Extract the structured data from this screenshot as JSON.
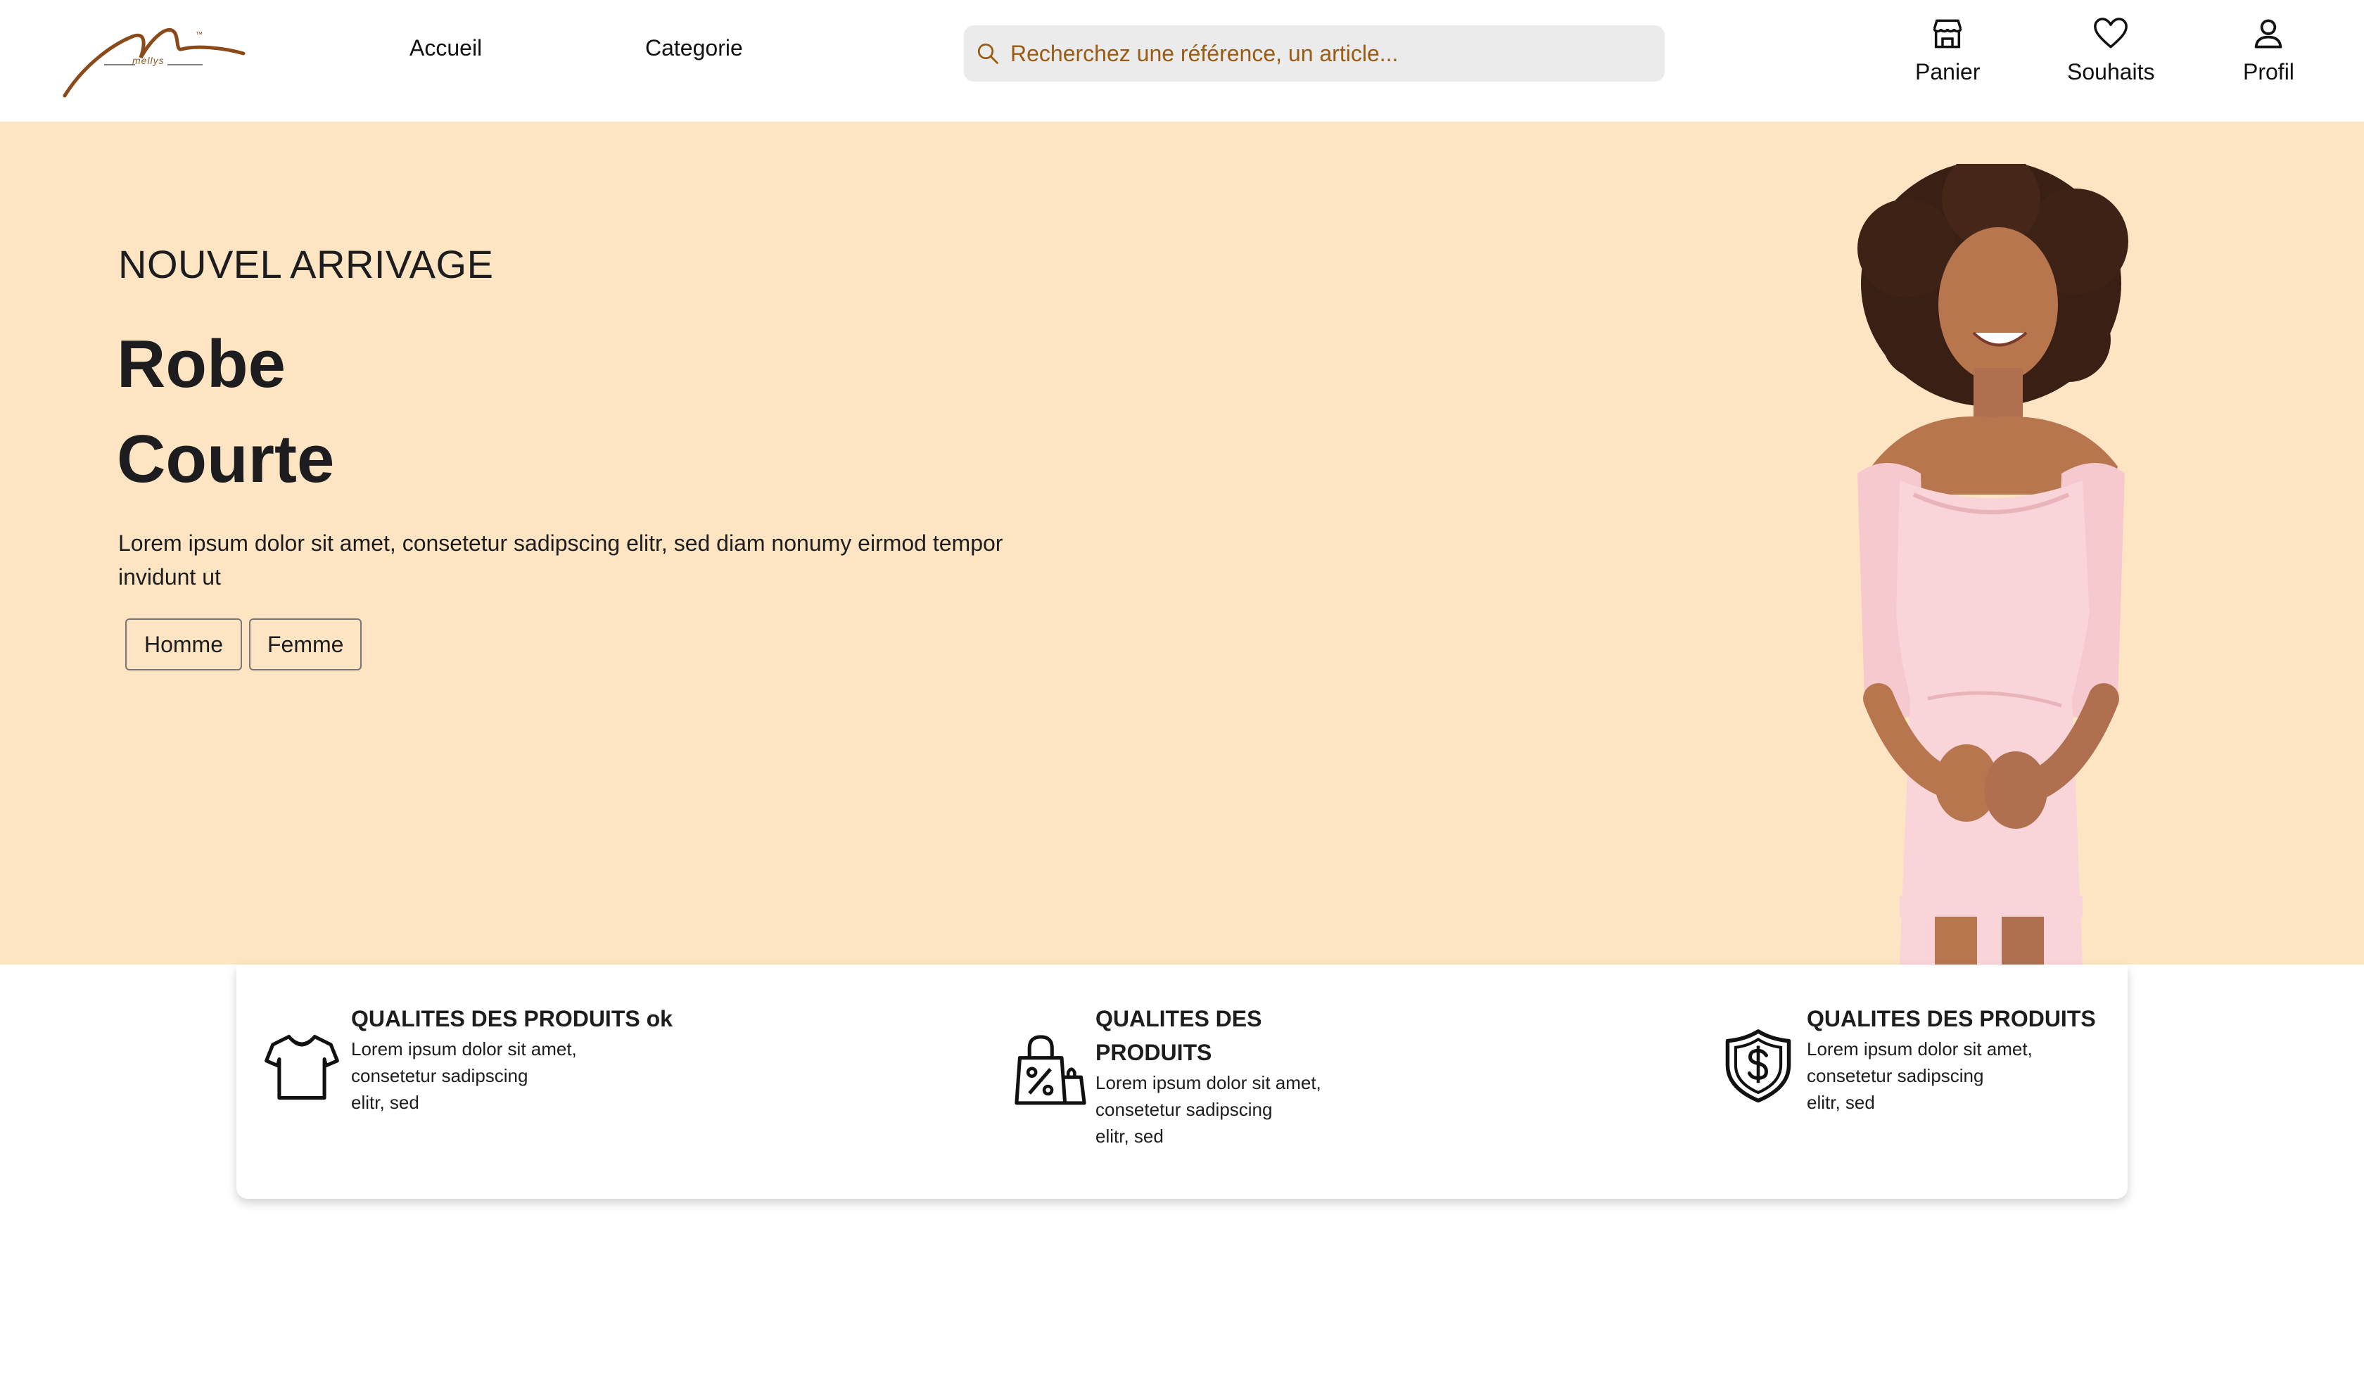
{
  "header": {
    "logo_text": "mellys",
    "nav": [
      {
        "label": "Accueil"
      },
      {
        "label": "Categorie"
      }
    ],
    "search": {
      "placeholder": "Recherchez une référence, un article...",
      "value": ""
    },
    "actions": [
      {
        "label": "Panier",
        "icon": "store-icon"
      },
      {
        "label": "Souhaits",
        "icon": "heart-icon"
      },
      {
        "label": "Profil",
        "icon": "user-icon"
      }
    ]
  },
  "hero": {
    "kicker": "NOUVEL ARRIVAGE",
    "title_line1": "Robe",
    "title_line2": "Courte",
    "description": "Lorem ipsum dolor sit amet, consetetur sadipscing elitr, sed diam nonumy eirmod tempor invidunt ut",
    "buttons": [
      {
        "label": "Homme"
      },
      {
        "label": "Femme"
      }
    ]
  },
  "features": [
    {
      "icon": "tshirt-icon",
      "title": "QUALITES DES PRODUITS ok",
      "text": "Lorem ipsum dolor sit amet,\nconsetetur sadipscing\nelitr, sed"
    },
    {
      "icon": "shopping-bag-percent-icon",
      "title": "QUALITES DES\nPRODUITS",
      "text": "Lorem ipsum dolor sit amet,\nconsetetur sadipscing\nelitr, sed"
    },
    {
      "icon": "shield-dollar-icon",
      "title": "QUALITES DES PRODUITS",
      "text": "Lorem ipsum dolor sit amet,\nconsetetur sadipscing\nelitr, sed"
    }
  ],
  "colors": {
    "hero_background": "#fde5c4",
    "search_text": "#9a5b12",
    "search_background": "#ebebeb",
    "logo_brown": "#8a4a1a"
  }
}
